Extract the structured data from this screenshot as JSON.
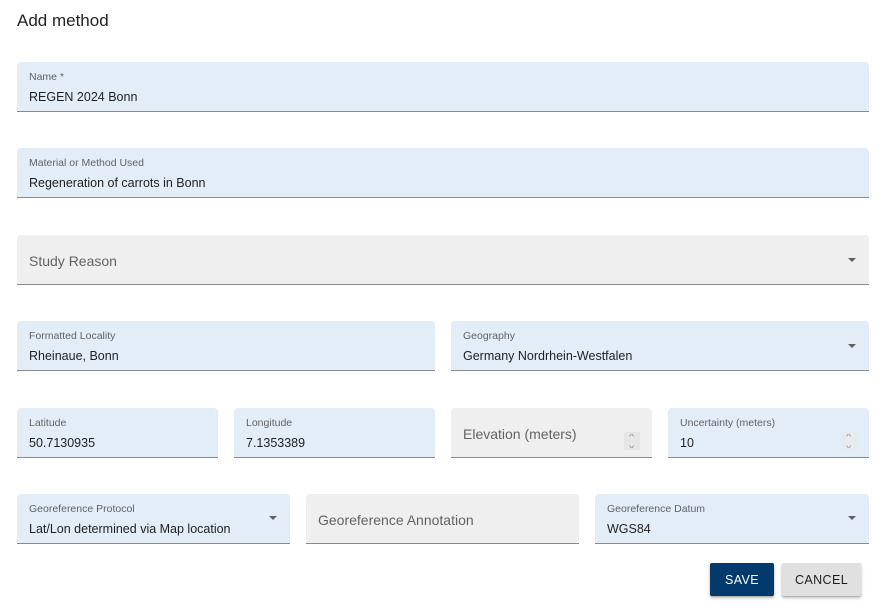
{
  "dialog": {
    "title": "Add method"
  },
  "fields": {
    "name": {
      "label": "Name *",
      "value": "REGEN 2024 Bonn"
    },
    "material": {
      "label": "Material or Method Used",
      "value": "Regeneration of carrots in Bonn"
    },
    "study_reason": {
      "placeholder": "Study Reason",
      "icon": "dropdown-caret-icon"
    },
    "formatted_locality": {
      "label": "Formatted Locality",
      "value": "Rheinaue, Bonn"
    },
    "geography": {
      "label": "Geography",
      "value": "Germany Nordrhein-Westfalen",
      "icon": "dropdown-caret-icon"
    },
    "latitude": {
      "label": "Latitude",
      "value": "50.7130935"
    },
    "longitude": {
      "label": "Longitude",
      "value": "7.1353389"
    },
    "elevation": {
      "placeholder": "Elevation (meters)",
      "icon": "number-spinner-icon"
    },
    "uncertainty": {
      "label": "Uncertainty (meters)",
      "value": "10",
      "icon": "number-spinner-icon"
    },
    "georef_protocol": {
      "label": "Georeference Protocol",
      "value": "Lat/Lon determined via Map location",
      "icon": "dropdown-caret-icon"
    },
    "georef_annotation": {
      "placeholder": "Georeference Annotation"
    },
    "georef_datum": {
      "label": "Georeference Datum",
      "value": "WGS84",
      "icon": "dropdown-caret-icon"
    }
  },
  "actions": {
    "save_label": "SAVE",
    "cancel_label": "CANCEL"
  },
  "colors": {
    "primary": "#023a6e",
    "filled_field_bg": "#e3edf7",
    "empty_field_bg": "#efefef",
    "cancel_bg": "#e0e0e0"
  }
}
